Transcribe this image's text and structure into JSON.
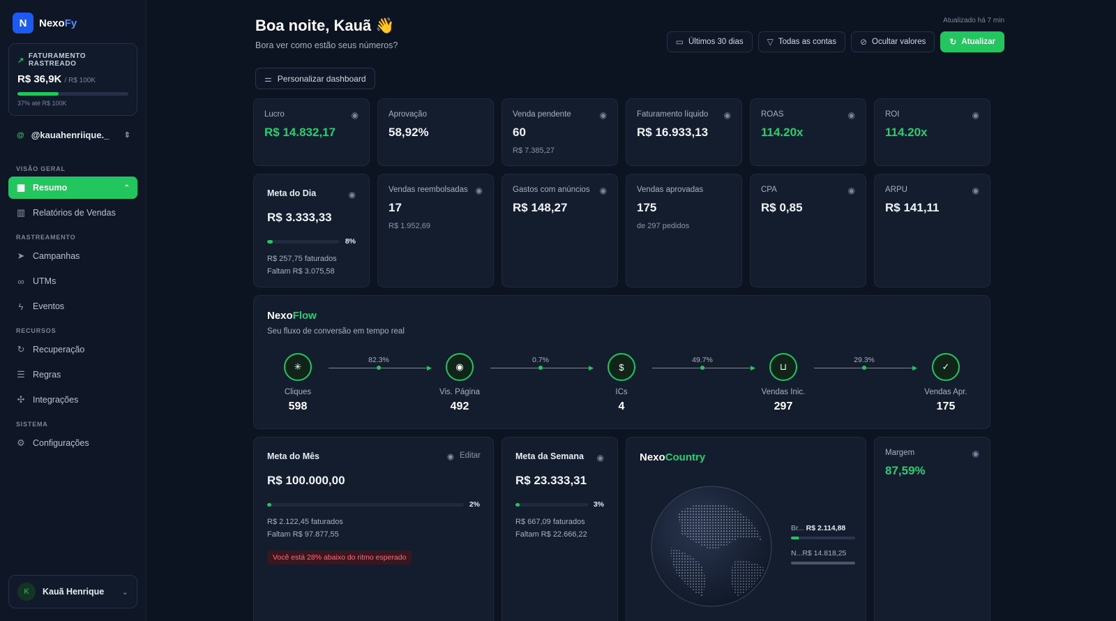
{
  "brand": {
    "name_a": "Nexo",
    "name_b": "Fy",
    "logo": "N"
  },
  "revenue": {
    "label": "FATURAMENTO RASTREADO",
    "value": "R$ 36,9K",
    "target": "/ R$ 100K",
    "progress": 0.37,
    "footer": "37% até R$ 100K"
  },
  "account": {
    "at": "@",
    "handle": "@kauahenriique._"
  },
  "nav": {
    "section_overview": "VISÃO GERAL",
    "resumo": "Resumo",
    "relatorios": "Relatórios de Vendas",
    "section_tracking": "RASTREAMENTO",
    "campanhas": "Campanhas",
    "utms": "UTMs",
    "eventos": "Eventos",
    "section_resources": "RECURSOS",
    "recuperacao": "Recuperação",
    "regras": "Regras",
    "integracoes": "Integrações",
    "section_system": "SISTEMA",
    "configuracoes": "Configurações"
  },
  "user": {
    "initial": "K",
    "name": "Kauã Henrique"
  },
  "header": {
    "greeting": "Boa noite, Kauã 👋",
    "subtitle": "Bora ver como estão seus números?",
    "updated": "Atualizado há 7 min",
    "period": "Últimos 30 dias",
    "accounts": "Todas as contas",
    "hide": "Ocultar valores",
    "refresh": "Atualizar",
    "customize": "Personalizar dashboard"
  },
  "metrics": {
    "lucro": {
      "label": "Lucro",
      "value": "R$ 14.832,17"
    },
    "aprovacao": {
      "label": "Aprovação",
      "value": "58,92%"
    },
    "pendente": {
      "label": "Venda pendente",
      "value": "60",
      "sub": "R$ 7.385,27"
    },
    "liquido": {
      "label": "Faturamento líquido",
      "value": "R$ 16.933,13"
    },
    "roas": {
      "label": "ROAS",
      "value": "114.20x"
    },
    "roi": {
      "label": "ROI",
      "value": "114.20x"
    },
    "reembolsadas": {
      "label": "Vendas reembolsadas",
      "value": "17",
      "sub": "R$ 1.952,69"
    },
    "gastos": {
      "label": "Gastos com anúncios",
      "value": "R$ 148,27"
    },
    "aprovadas": {
      "label": "Vendas aprovadas",
      "value": "175",
      "sub": "de 297 pedidos"
    },
    "cpa": {
      "label": "CPA",
      "value": "R$ 0,85"
    },
    "arpu": {
      "label": "ARPU",
      "value": "R$ 141,11"
    },
    "margem": {
      "label": "Margem",
      "value": "87,59%"
    }
  },
  "meta_dia": {
    "label": "Meta do Dia",
    "value": "R$ 3.333,33",
    "pct": "8%",
    "progress": 0.08,
    "billed": "R$ 257,75 faturados",
    "missing": "Faltam R$ 3.075,58"
  },
  "meta_mes": {
    "label": "Meta do Mês",
    "edit": "Editar",
    "value": "R$ 100.000,00",
    "pct": "2%",
    "progress": 0.02,
    "billed": "R$ 2.122,45 faturados",
    "missing": "Faltam R$ 97.877,55",
    "warning": "Você está 28% abaixo do ritmo esperado"
  },
  "meta_semana": {
    "label": "Meta da Semana",
    "value": "R$ 23.333,31",
    "pct": "3%",
    "progress": 0.03,
    "billed": "R$ 667,09 faturados",
    "missing": "Faltam R$ 22.666,22"
  },
  "flow": {
    "title_a": "Nexo",
    "title_b": "Flow",
    "subtitle": "Seu fluxo de conversão em tempo real",
    "nodes": [
      {
        "label": "Cliques",
        "value": "598",
        "icon": "click-icon"
      },
      {
        "label": "Vis. Página",
        "value": "492",
        "icon": "eye-icon"
      },
      {
        "label": "ICs",
        "value": "4",
        "icon": "receipt-icon"
      },
      {
        "label": "Vendas Inic.",
        "value": "297",
        "icon": "cart-icon"
      },
      {
        "label": "Vendas Apr.",
        "value": "175",
        "icon": "check-circle-icon"
      }
    ],
    "rates": [
      "82.3%",
      "0.7%",
      "49.7%",
      "29.3%"
    ]
  },
  "country": {
    "title_a": "Nexo",
    "title_b": "Country",
    "rows": [
      {
        "name": "Br...",
        "value": "R$ 2.114,88",
        "progress": 0.12
      },
      {
        "name": "N...",
        "value": "R$ 14.818,25",
        "progress": 1.0
      }
    ]
  },
  "colors": {
    "accent": "#22c55e",
    "brand": "#1d5bf0",
    "background": "#0d1421"
  }
}
